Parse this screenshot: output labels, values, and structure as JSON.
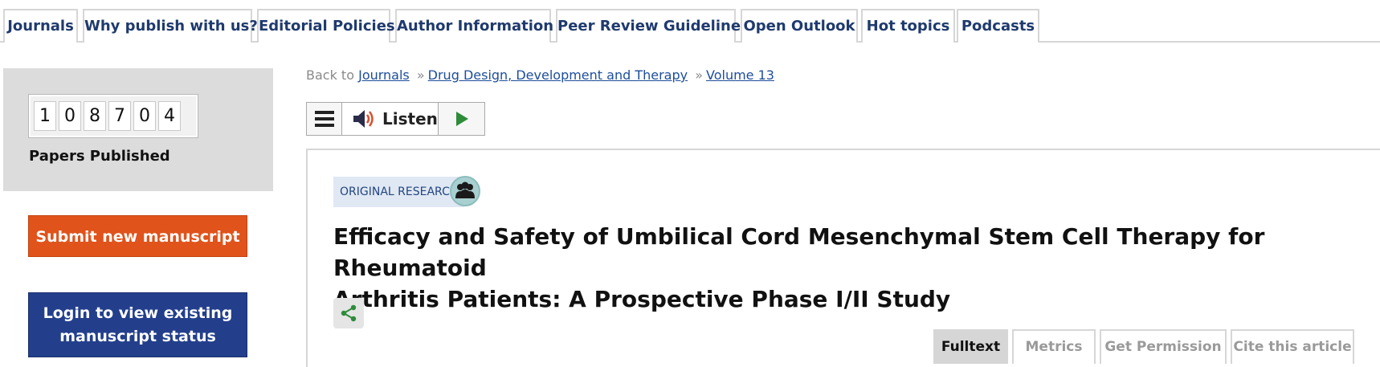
{
  "nav": {
    "tabs": [
      {
        "label": "Journals"
      },
      {
        "label": "Why publish with us?"
      },
      {
        "label": "Editorial Policies"
      },
      {
        "label": "Author Information"
      },
      {
        "label": "Peer Review Guidelines"
      },
      {
        "label": "Open Outlook"
      },
      {
        "label": "Hot topics"
      },
      {
        "label": "Podcasts"
      }
    ]
  },
  "sidebar": {
    "counter_digits": [
      "1",
      "0",
      "8",
      "7",
      "0",
      "4"
    ],
    "counter_label": "Papers Published",
    "submit_label": "Submit new manuscript",
    "login_line1": "Login to view existing",
    "login_line2": "manuscript status"
  },
  "breadcrumb": {
    "prefix": "Back to",
    "items": [
      "Journals",
      "Drug Design, Development and Therapy",
      "Volume 13"
    ],
    "separator": "»"
  },
  "listen": {
    "label": "Listen",
    "icons": {
      "menu": "menu-icon",
      "speaker": "speaker-icon",
      "play": "play-icon"
    },
    "play_color": "#2e8b3a",
    "speaker_color": "#d9502e"
  },
  "article": {
    "type_badge": "ORIGINAL RESEARCH",
    "title_line1": "Efficacy and Safety of Umbilical Cord Mesenchymal Stem Cell Therapy for Rheumatoid",
    "title_line2": "Arthritis Patients: A Prospective Phase I/II Study",
    "share_icon": "share-icon",
    "share_color": "#2e8b3a",
    "tabs": [
      {
        "label": "Fulltext",
        "active": true
      },
      {
        "label": "Metrics",
        "active": false
      },
      {
        "label": "Get Permission",
        "active": false
      },
      {
        "label": "Cite this article",
        "active": false
      }
    ]
  },
  "colors": {
    "nav_text": "#1f3a6e",
    "submit_bg": "#e0531b",
    "login_bg": "#233f8c",
    "link": "#1d4e9c"
  }
}
